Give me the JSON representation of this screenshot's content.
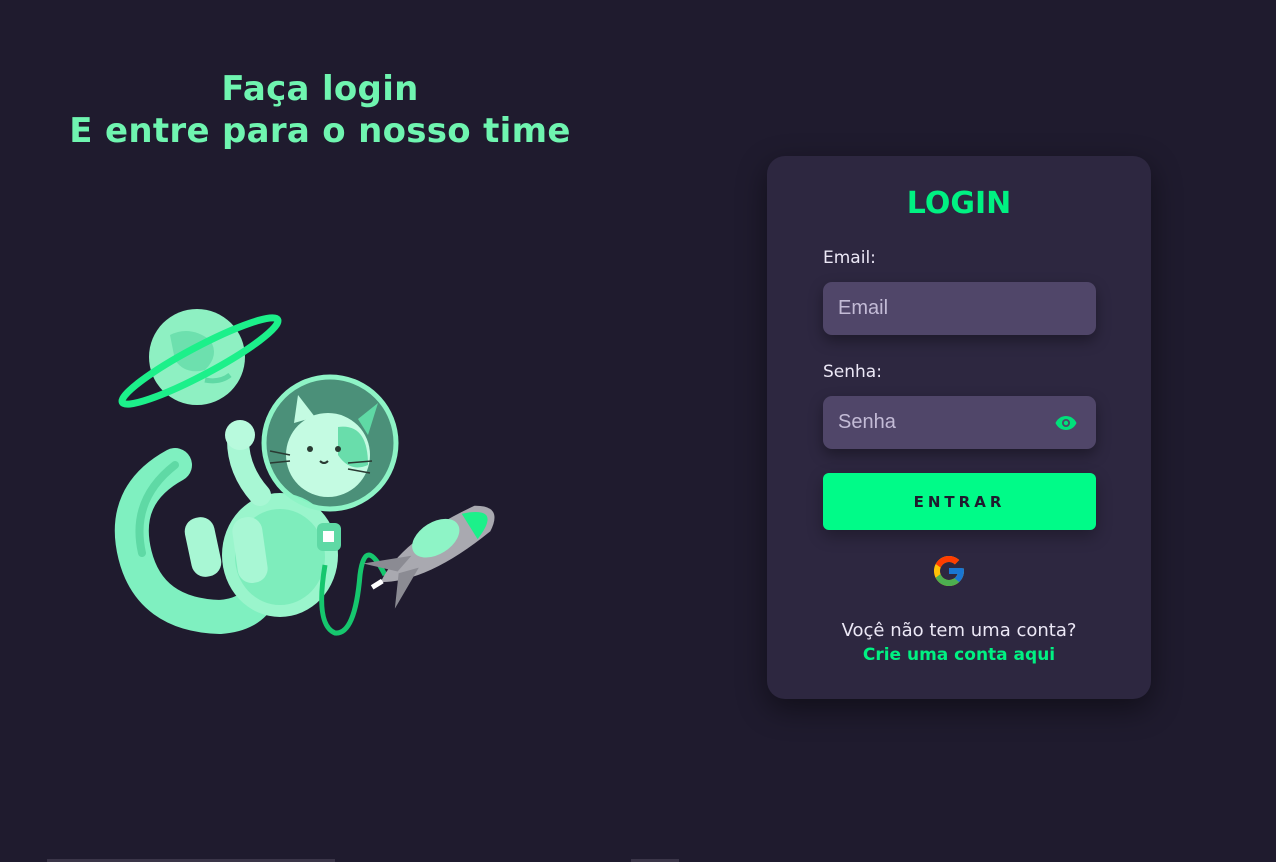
{
  "hero": {
    "line1": "Faça login",
    "line2": "E entre para o nosso time"
  },
  "illustration": {
    "icon": "astronaut-cat-illustration",
    "accent": "#6ff5b0"
  },
  "login": {
    "title": "LOGIN",
    "email_label": "Email:",
    "email_placeholder": "Email",
    "email_value": "",
    "password_label": "Senha:",
    "password_placeholder": "Senha",
    "password_value": "",
    "password_toggle_icon": "eye-icon",
    "submit_label": "ENTRAR",
    "google_icon": "google-icon",
    "no_account_text": "Voçê não tem uma conta?",
    "signup_link": "Crie uma conta aqui"
  },
  "colors": {
    "background": "#1f1b2e",
    "card": "#2d2740",
    "input": "#504669",
    "accent": "#00fb88"
  }
}
